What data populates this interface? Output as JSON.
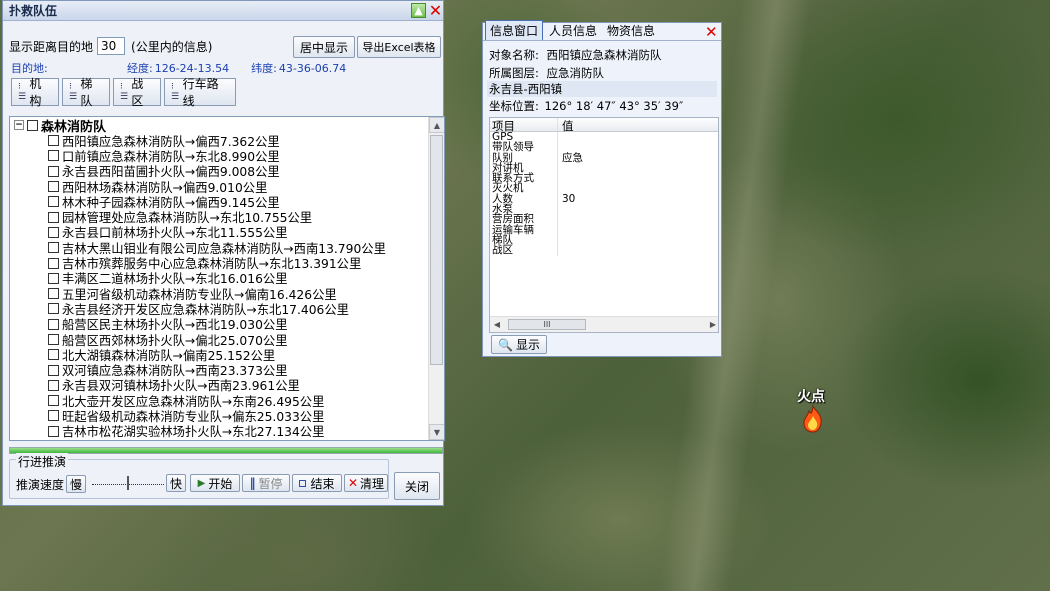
{
  "map": {
    "fire_label": "火点"
  },
  "rescue_panel": {
    "title": "扑救队伍",
    "distance_label": "显示距离目的地",
    "distance_value": "30",
    "distance_unit": "(公里内的信息)",
    "center_button": "居中显示",
    "export_button": "导出Excel表格",
    "destination_label": "目的地:",
    "longitude_label": "经度:",
    "longitude_value": "126-24-13.54",
    "latitude_label": "纬度:",
    "latitude_value": "43-36-06.74",
    "tools": [
      {
        "label": "机构"
      },
      {
        "label": "梯队"
      },
      {
        "label": "战区"
      },
      {
        "label": "行车路线"
      }
    ],
    "tree_root": "森林消防队",
    "tree_items": [
      "西阳镇应急森林消防队→偏西7.362公里",
      "口前镇应急森林消防队→东北8.990公里",
      "永吉县西阳苗圃扑火队→偏西9.008公里",
      "西阳林场森林消防队→偏西9.010公里",
      "林木种子园森林消防队→偏西9.145公里",
      "园林管理处应急森林消防队→东北10.755公里",
      "永吉县口前林场扑火队→东北11.555公里",
      "吉林大黑山钼业有限公司应急森林消防队→西南13.790公里",
      "吉林市殡葬服务中心应急森林消防队→东北13.391公里",
      "丰满区二道林场扑火队→东北16.016公里",
      "五里河省级机动森林消防专业队→偏南16.426公里",
      "永吉县经济开发区应急森林消防队→东北17.406公里",
      "船营区民主林场扑火队→西北19.030公里",
      "船营区西郊林场扑火队→偏北25.070公里",
      "北大湖镇森林消防队→偏南25.152公里",
      "双河镇应急森林消防队→西南23.373公里",
      "永吉县双河镇林场扑火队→西南23.961公里",
      "北大壶开发区应急森林消防队→东南26.495公里",
      "旺起省级机动森林消防专业队→偏东25.033公里",
      "吉林市松花湖实验林场扑火队→东北27.134公里",
      "…"
    ],
    "playback": {
      "title": "行进推演",
      "speed_label": "推演速度",
      "slow_label": "慢",
      "fast_label": "快",
      "speed_fraction": 0.5,
      "start_button": "开始",
      "pause_button": "暂停",
      "end_button": "结束",
      "clear_button": "清理"
    },
    "close_button": "关闭"
  },
  "info_panel": {
    "tabs": [
      "信息窗口",
      "人员信息",
      "物资信息"
    ],
    "object_name_label": "对象名称:",
    "object_name": "西阳镇应急森林消防队",
    "layer_label": "所属图层:",
    "layer": "应急消防队",
    "region": "永吉县-西阳镇",
    "coord_label": "坐标位置:",
    "coord_value": "126° 18′ 47″   43° 35′ 39″",
    "grid_headers": [
      "项目",
      "值"
    ],
    "grid_rows": [
      [
        "GPS",
        ""
      ],
      [
        "带队领导",
        ""
      ],
      [
        "队别",
        "应急"
      ],
      [
        "对讲机",
        ""
      ],
      [
        "联系方式",
        ""
      ],
      [
        "灭火机",
        ""
      ],
      [
        "人数",
        "30"
      ],
      [
        "水泵",
        ""
      ],
      [
        "营房面积",
        ""
      ],
      [
        "运输车辆",
        ""
      ],
      [
        "梯队",
        ""
      ],
      [
        "战区",
        ""
      ]
    ],
    "show_button": "显示"
  }
}
